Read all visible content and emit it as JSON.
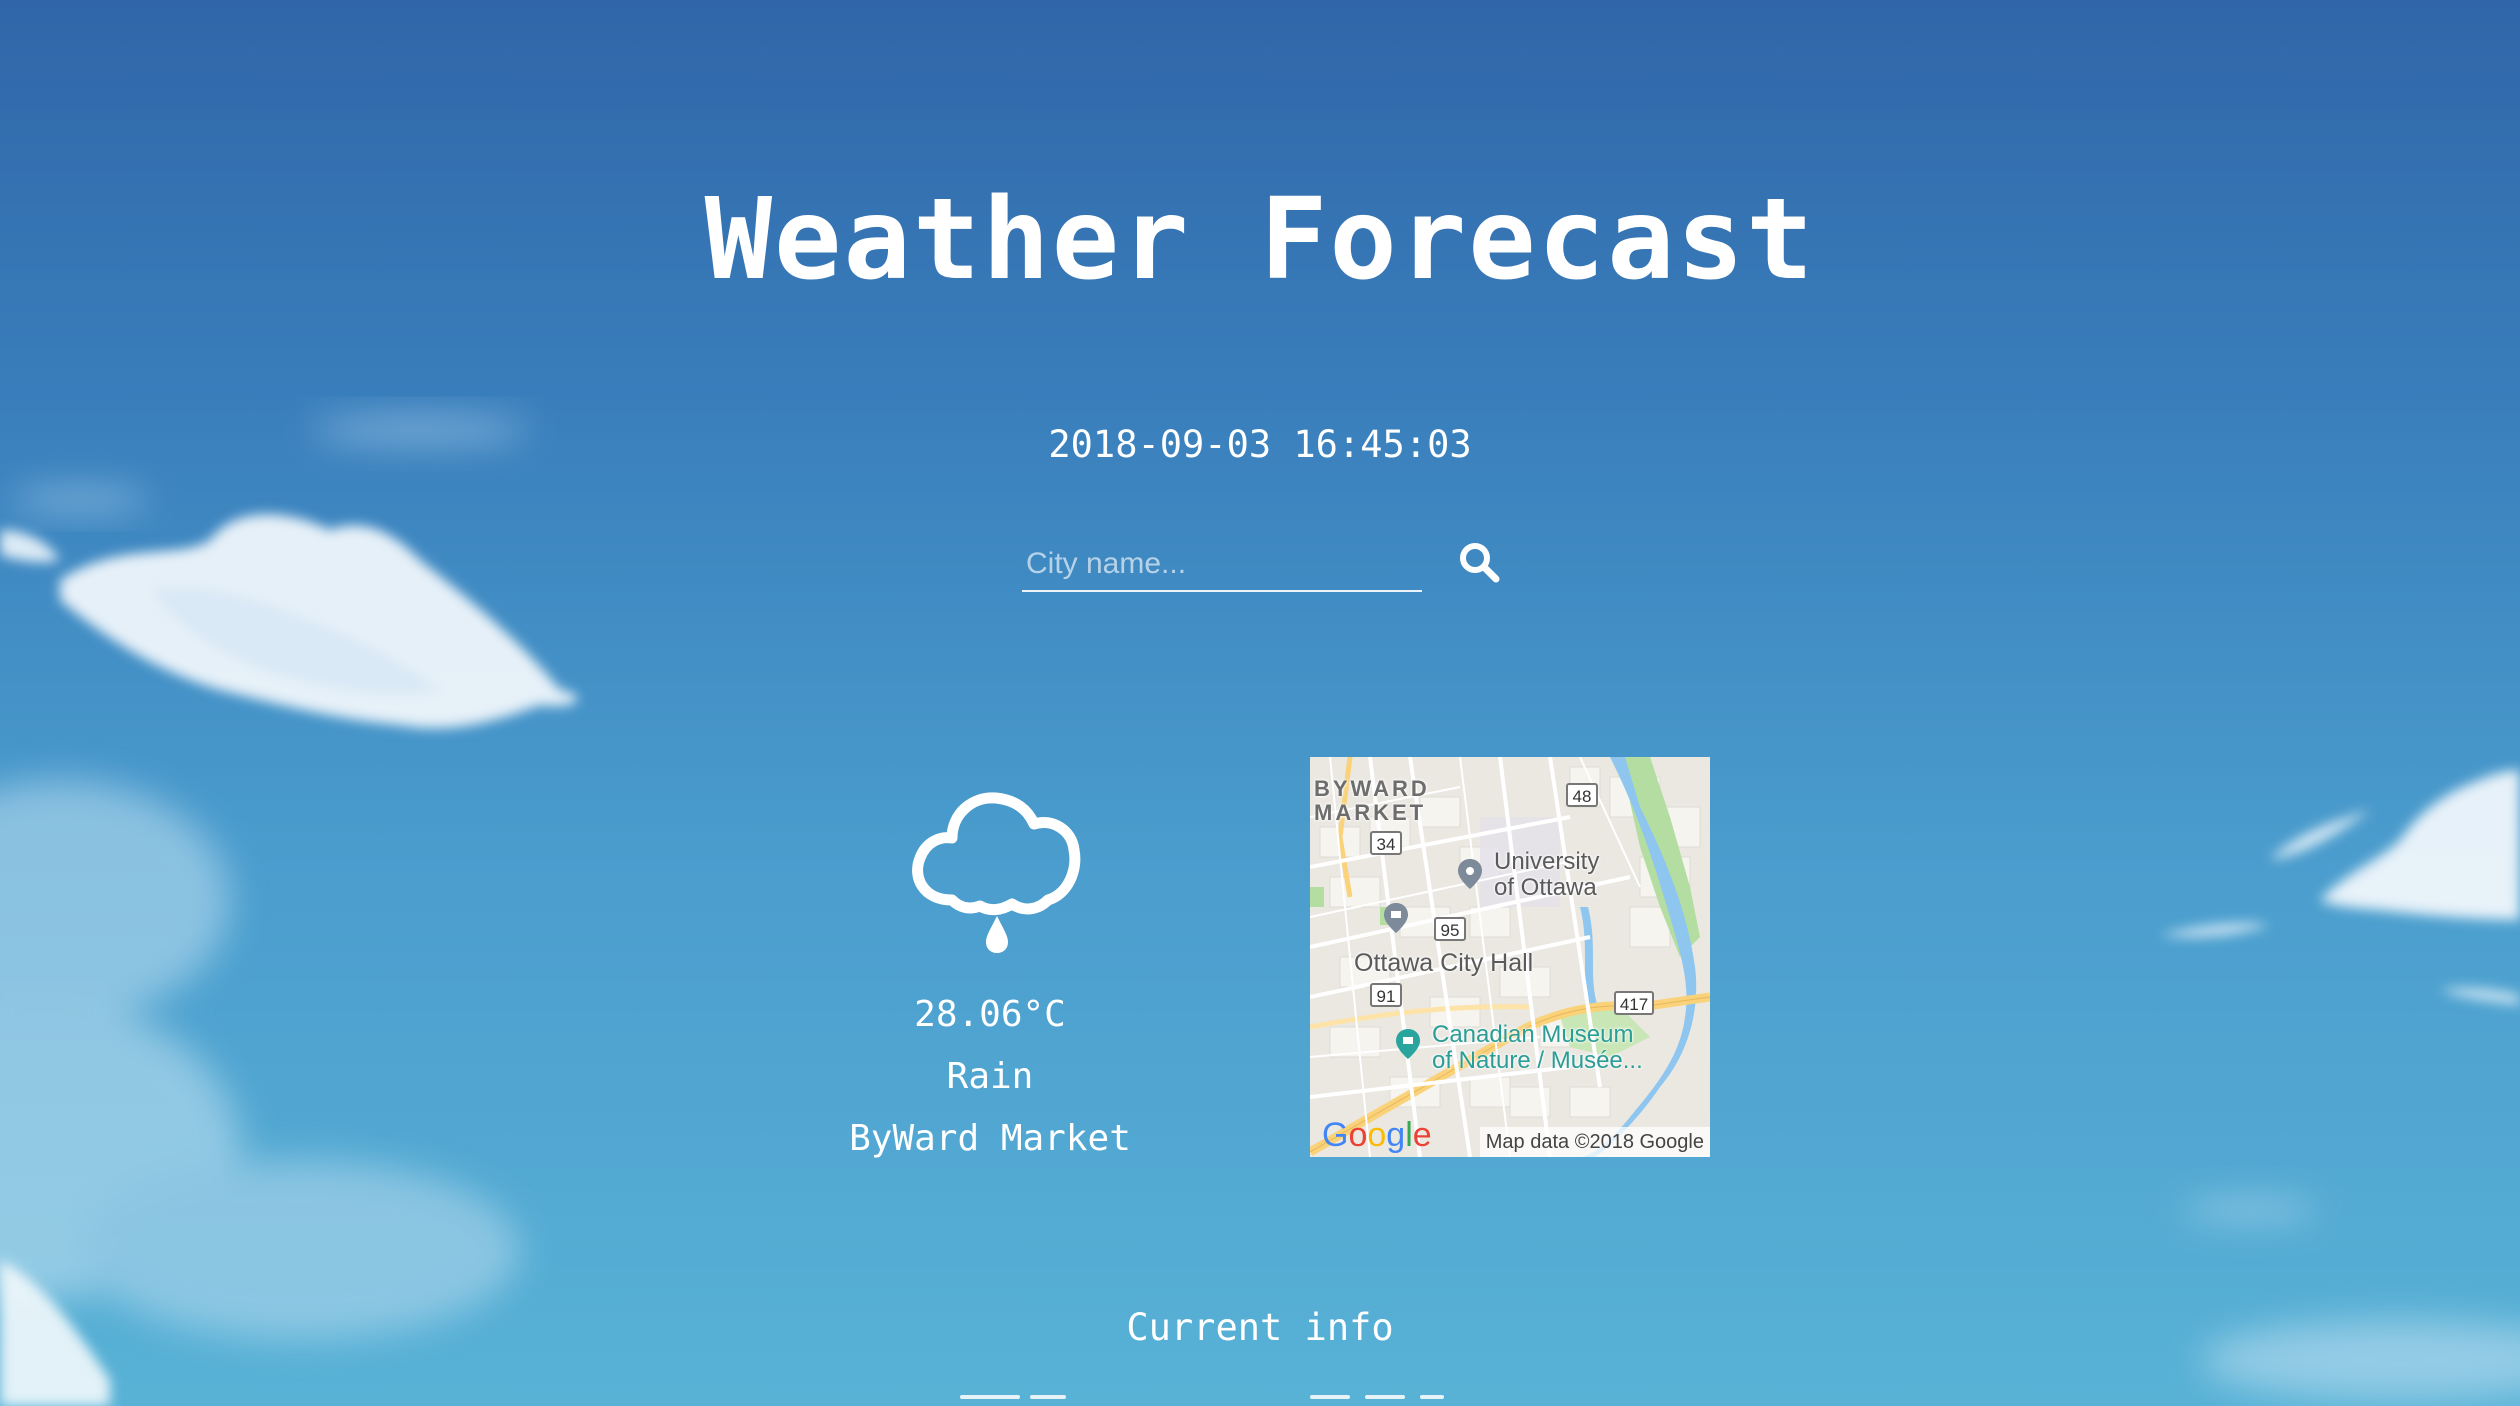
{
  "page": {
    "title": "Weather Forecast",
    "datetime": "2018-09-03 16:45:03"
  },
  "search": {
    "placeholder": "City name...",
    "value": "",
    "button_icon": "search-icon"
  },
  "weather": {
    "icon": "rain-cloud-icon",
    "temperature": "28.06°C",
    "condition": "Rain",
    "location": "ByWard Market"
  },
  "map": {
    "labels": {
      "district_line1": "BYWARD",
      "district_line2": "MARKET",
      "university_line1": "University",
      "university_line2": "of Ottawa",
      "city_hall": "Ottawa City Hall",
      "museum_line1": "Canadian Museum",
      "museum_line2": "of Nature / Musée..."
    },
    "shields": {
      "r48": "48",
      "r34": "34",
      "r95": "95",
      "r91": "91",
      "r417": "417"
    },
    "logo": "Google",
    "attribution": "Map data ©2018 Google"
  },
  "section": {
    "current_info": "Current info"
  },
  "colors": {
    "sky_top": "#3066a9",
    "sky_bottom": "#58b2d6",
    "text": "#ffffff",
    "map_water": "#8ec6f0",
    "map_park": "#b4dda1",
    "map_highway": "#f9d27a"
  }
}
